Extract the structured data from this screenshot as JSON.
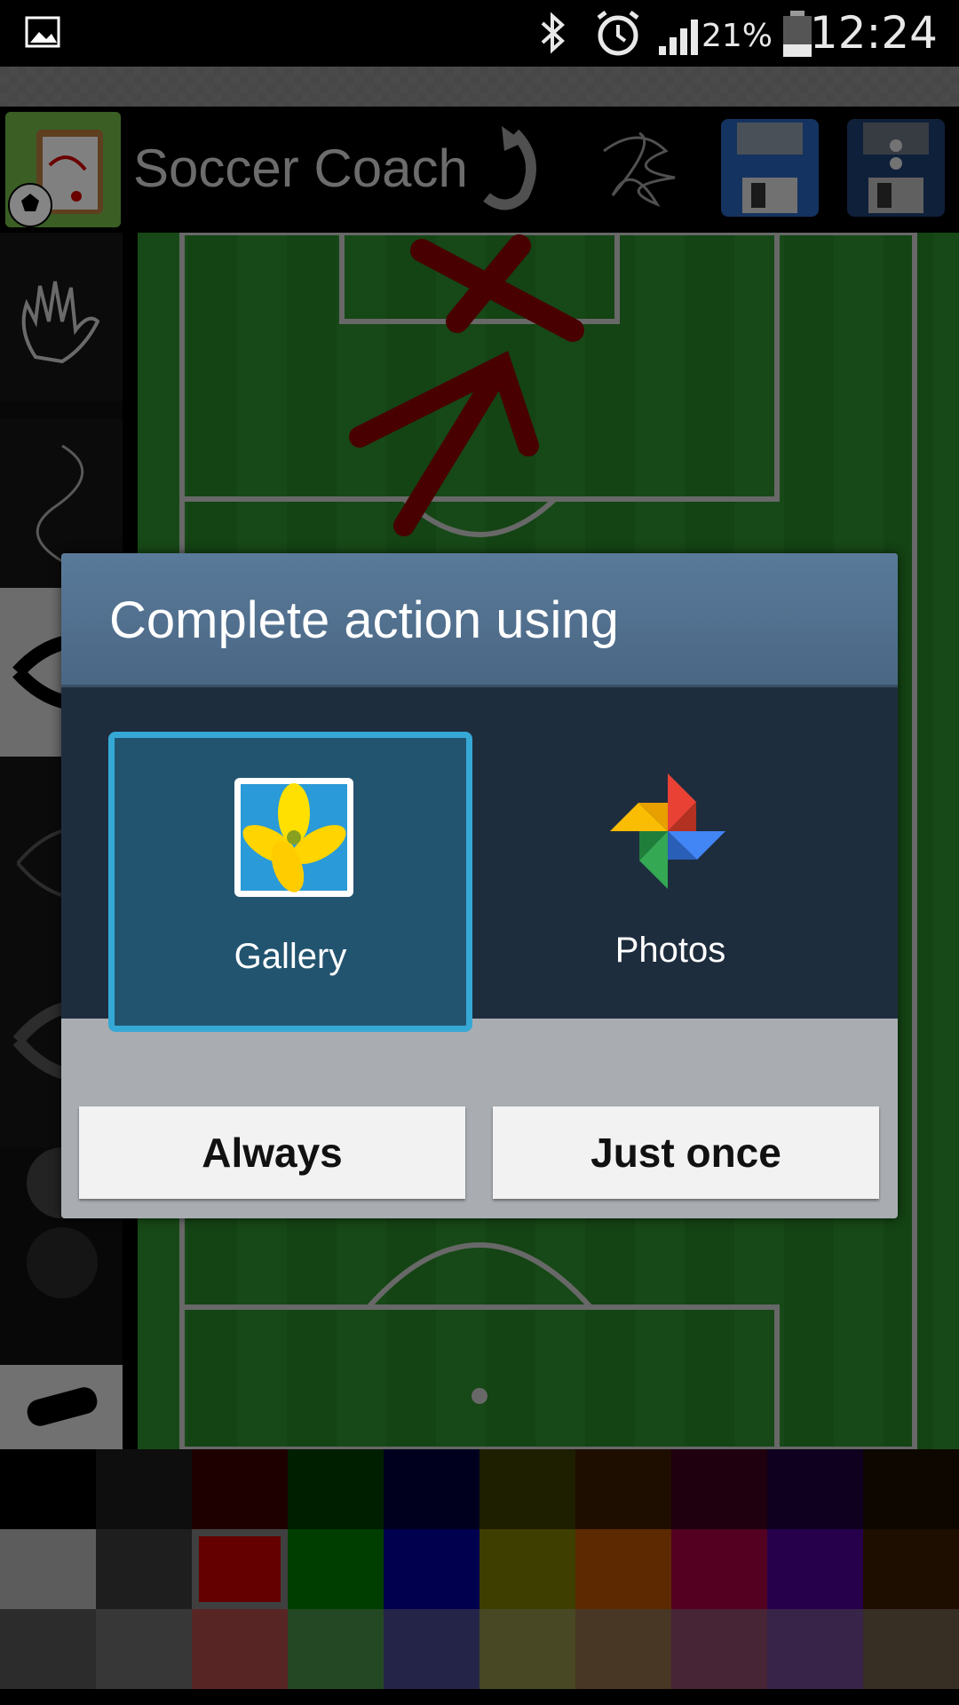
{
  "status_bar": {
    "time": "12:24",
    "battery_percent": "21%",
    "icons": [
      "gallery-notification-icon",
      "bluetooth-icon",
      "alarm-icon",
      "signal-icon",
      "battery-icon"
    ]
  },
  "toolbar": {
    "app_title": "Soccer Coach",
    "icons": [
      "undo-icon",
      "clear-scribble-icon",
      "save-icon",
      "save-as-icon"
    ]
  },
  "left_tools": [
    "hand-tool-icon",
    "curve-tool-icon",
    "eye-shape-tool-icon",
    "brush-tool-icon",
    "eraser-tool-icon"
  ],
  "dialog": {
    "title": "Complete action using",
    "apps": [
      {
        "label": "Gallery",
        "icon": "gallery-app-icon",
        "selected": true
      },
      {
        "label": "Photos",
        "icon": "photos-app-icon",
        "selected": false
      }
    ],
    "buttons": {
      "always": "Always",
      "just_once": "Just once"
    }
  },
  "palette": {
    "selected_color": "#c00000",
    "rows": [
      [
        "#000000",
        "#1c1c1c",
        "#3a0000",
        "#003a00",
        "#00003a",
        "#3a3a00",
        "#3a1c00",
        "#3a001c",
        "#1c003a",
        "#1c0e00"
      ],
      [
        "#b0b0b0",
        "#3a3a3a",
        "#c00000",
        "#007800",
        "#000098",
        "#787800",
        "#b05000",
        "#a00040",
        "#4a0090",
        "#3a1c00"
      ],
      [
        "#555555",
        "#6a6a6a",
        "#aa4848",
        "#468a46",
        "#46468a",
        "#8a8a46",
        "#8a6a46",
        "#8a466a",
        "#6a468a",
        "#6a5846"
      ]
    ]
  }
}
